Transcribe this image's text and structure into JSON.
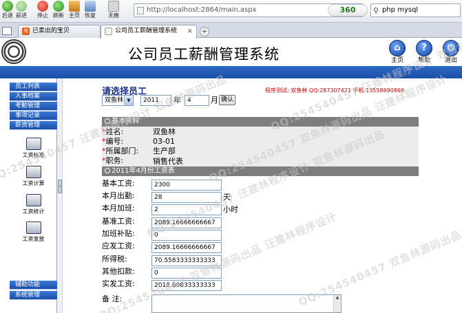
{
  "browser": {
    "nav_buttons": [
      {
        "label": "后退",
        "icon": "back-arrow-icon"
      },
      {
        "label": "前进",
        "icon": "forward-arrow-icon"
      },
      {
        "label": "停止",
        "icon": "stop-icon"
      },
      {
        "label": "刷新",
        "icon": "refresh-icon"
      },
      {
        "label": "主页",
        "icon": "home-icon"
      },
      {
        "label": "恢复",
        "icon": "restore-icon"
      },
      {
        "label": "无痕",
        "icon": "incognito-icon"
      }
    ],
    "address": "http://localhost:2864/main.aspx",
    "brand": "360",
    "search_text": "php mysql",
    "tabs": [
      {
        "label": "已卖出的宝贝",
        "active": false
      },
      {
        "label": "公司员工薪酬管理系统",
        "active": true
      }
    ]
  },
  "header": {
    "title": "公司员工薪酬管理系统",
    "buttons": [
      {
        "label": "主页",
        "glyph": "⌂"
      },
      {
        "label": "帮助",
        "glyph": "?"
      },
      {
        "label": "退出",
        "glyph": "⏻"
      }
    ]
  },
  "sidebar": {
    "top_items": [
      "员工列表",
      "人事档案",
      "考勤管理",
      "事项记录",
      "薪资管理"
    ],
    "tools": [
      "工资标准",
      "工资计算",
      "工资统计",
      "工资发放"
    ],
    "bottom_items": [
      "辅助功能",
      "系统管理"
    ]
  },
  "main": {
    "title": "请选择员工",
    "author_note": "程序测试: 双鱼林 QQ:287307421 手机:13558690869",
    "employee_select": "双鱼林",
    "year_value": "2011",
    "year_label": "年",
    "month_value": "4",
    "month_label": "月",
    "confirm_button": "确认",
    "basic_section": "基本资料",
    "basic": [
      {
        "label": "姓名:",
        "value": "双鱼林"
      },
      {
        "label": "编号:",
        "value": "03-01"
      },
      {
        "label": "所属部门:",
        "value": "生产部"
      },
      {
        "label": "职务:",
        "value": "销售代表"
      }
    ],
    "salary_section": "2011年4月份工资表",
    "salary": [
      {
        "label": "基本工资:",
        "value": "2300",
        "unit": ""
      },
      {
        "label": "本月出勤:",
        "value": "28",
        "unit": "天"
      },
      {
        "label": "本月加班:",
        "value": "2",
        "unit": "小时"
      },
      {
        "label": "基准工资:",
        "value": "2089.16666666667",
        "unit": ""
      },
      {
        "label": "加班补贴:",
        "value": "0",
        "unit": ""
      },
      {
        "label": "应发工资:",
        "value": "2089.16666666667",
        "unit": ""
      },
      {
        "label": "所得税:",
        "value": "70.5583333333333",
        "unit": ""
      },
      {
        "label": "其他扣款:",
        "value": "0",
        "unit": ""
      },
      {
        "label": "实发工资:",
        "value": "2018.60833333333",
        "unit": ""
      }
    ],
    "remark_label": "备  注:"
  },
  "watermark": {
    "texts": [
      "QQ:254540457 汪建林程序设计 双鱼林源码出品",
      "QQ:254540457 双鱼林源码出品 汪建林程序设计"
    ]
  },
  "colors": {
    "band_blue": "#1f57b3",
    "section_gray": "#7d7d7d",
    "title_navy": "#1b2f8a",
    "author_red": "#cc0000"
  }
}
